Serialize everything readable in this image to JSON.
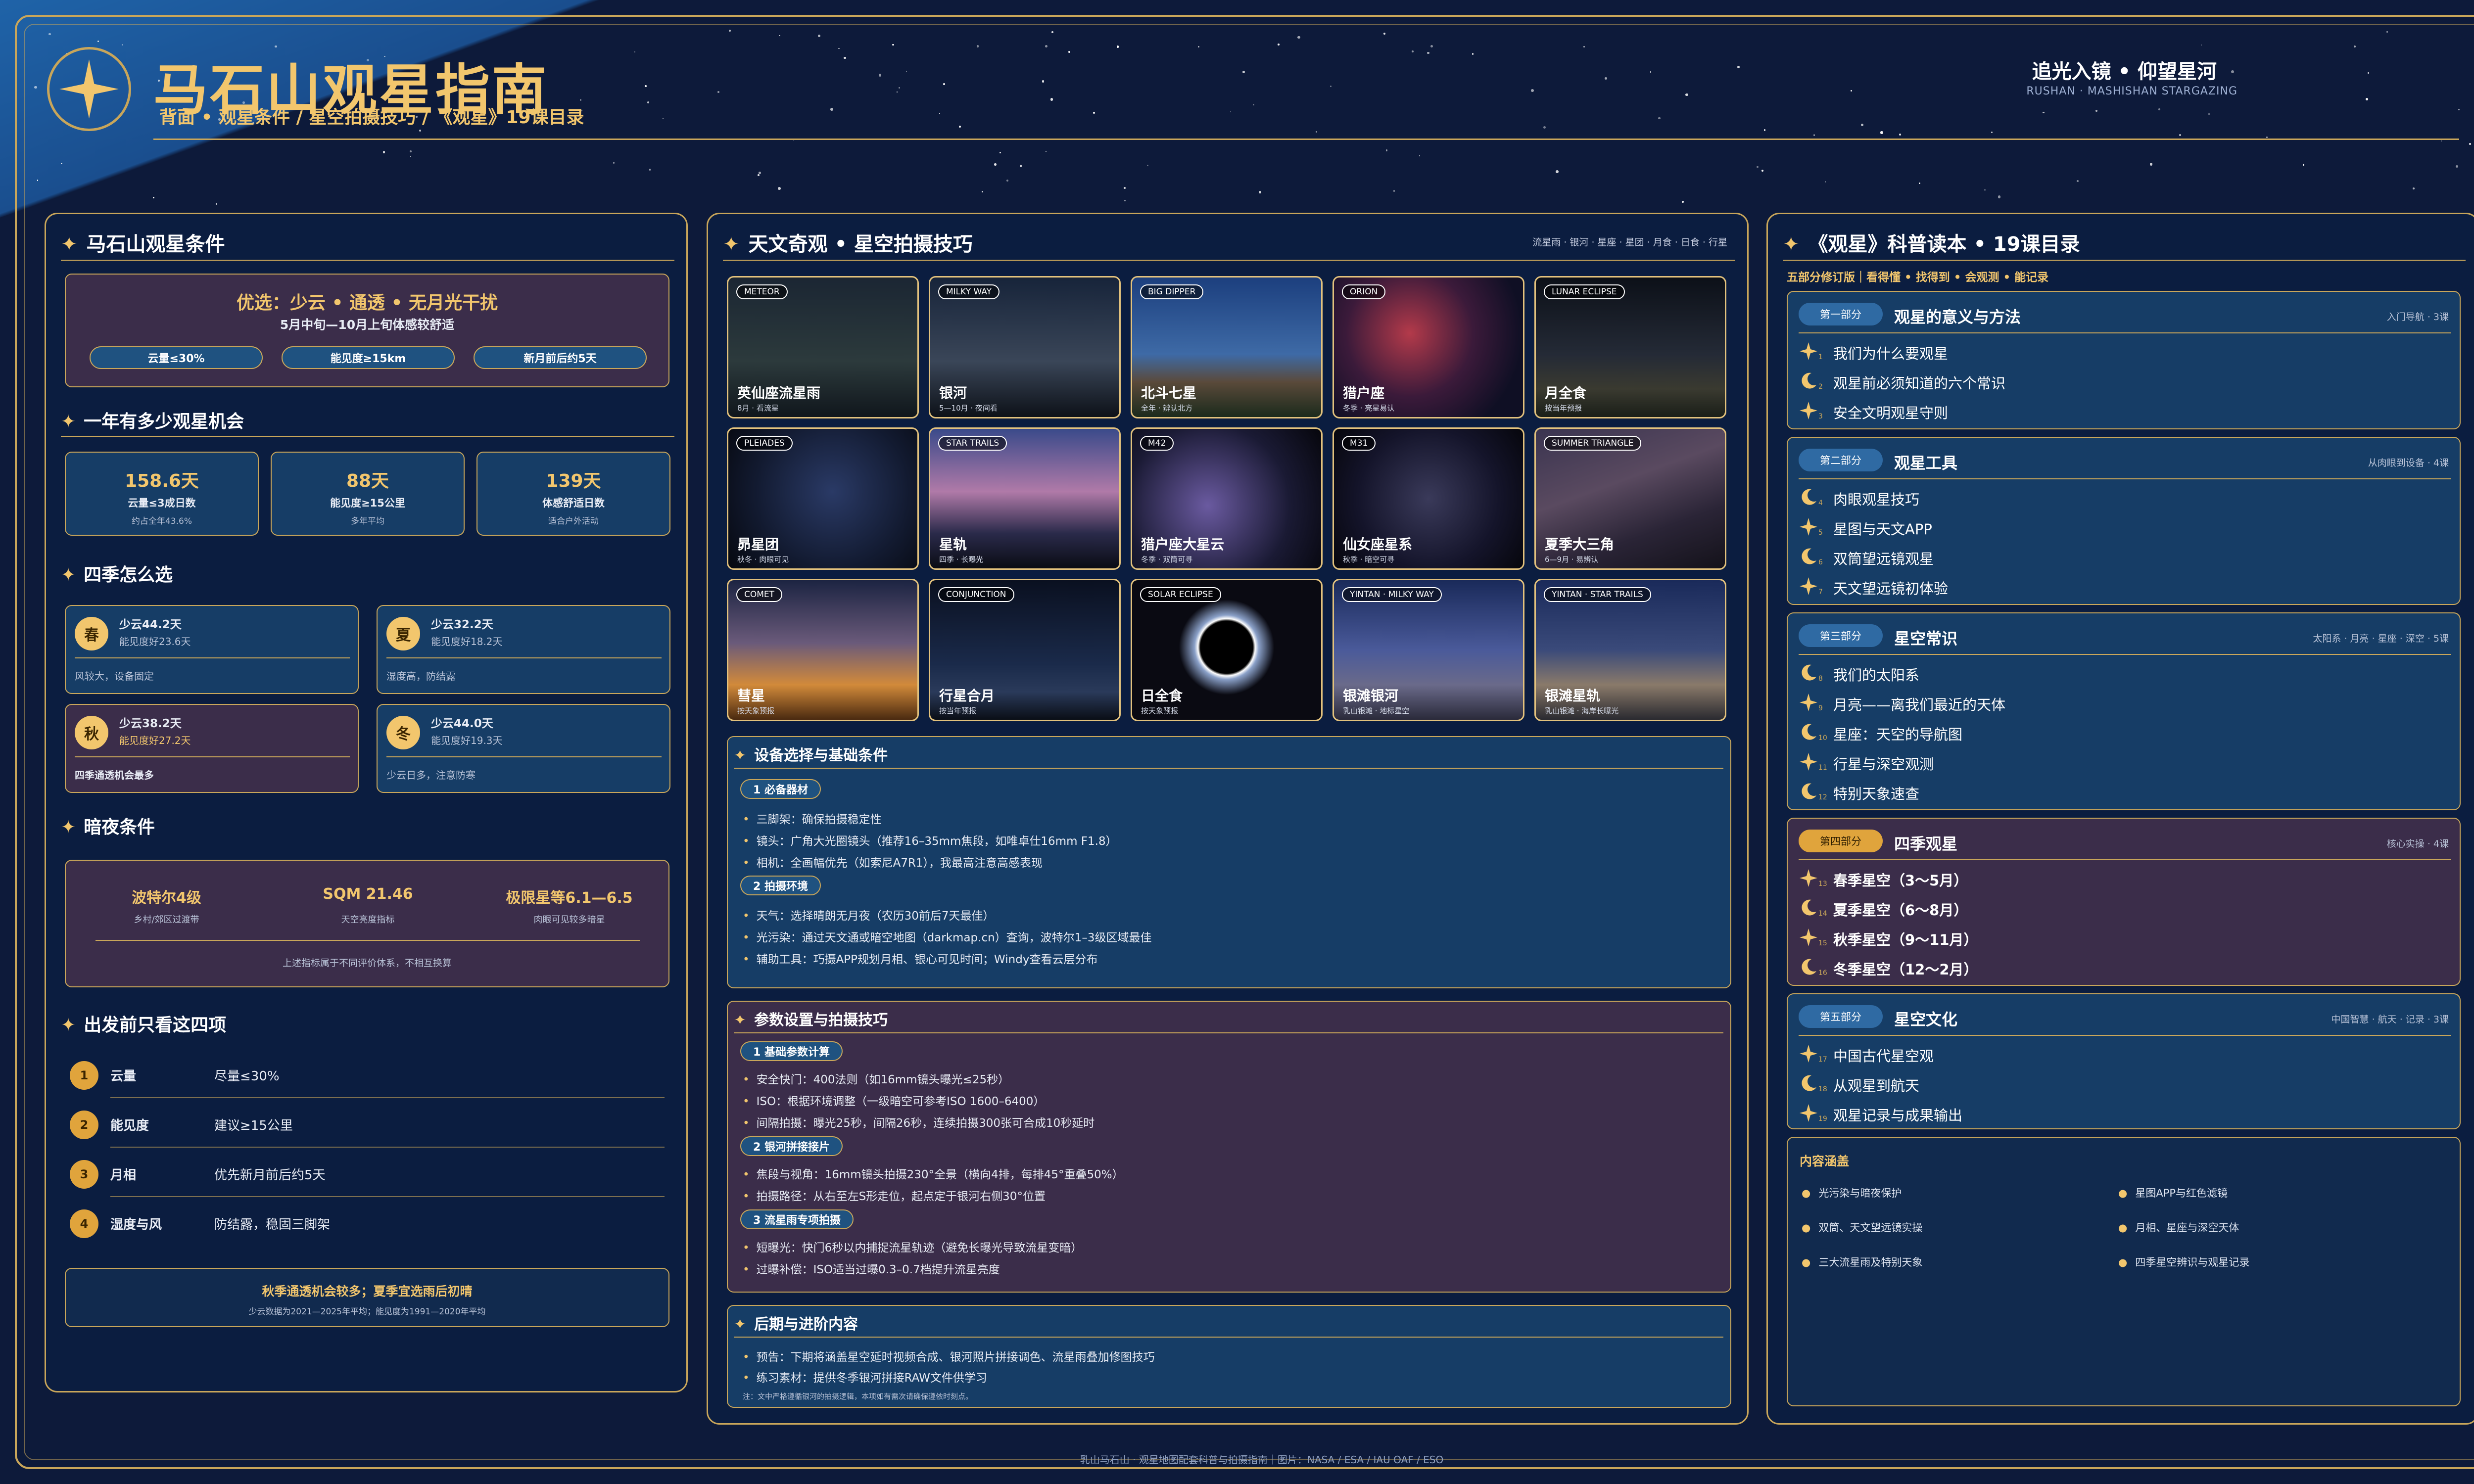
{
  "header": {
    "title": "马石山观星指南",
    "subtitle": "背面 • 观星条件  /  星空拍摄技巧  /  《观星》19课目录",
    "tagline": "追光入镜 • 仰望星河",
    "tagline_en": "RUSHAN · MASHISHAN STARGAZING"
  },
  "left": {
    "title": "马石山观星条件",
    "best": {
      "headline": "优选：少云 • 通透 • 无月光干扰",
      "period": "5月中旬—10月上旬体感较舒适",
      "pills": [
        "云量≤30%",
        "能见度≥15km",
        "新月前后约5天"
      ]
    },
    "chances": {
      "title": "一年有多少观星机会",
      "cards": [
        {
          "value": "158.6天",
          "label": "云量≤3成日数",
          "note": "约占全年43.6%"
        },
        {
          "value": "88天",
          "label": "能见度≥15公里",
          "note": "多年平均"
        },
        {
          "value": "139天",
          "label": "体感舒适日数",
          "note": "适合户外活动"
        }
      ]
    },
    "seasons": {
      "title": "四季怎么选",
      "items": [
        {
          "badge": "春",
          "line1": "少云44.2天",
          "line2": "能见度好23.6天",
          "note": "风较大，设备固定"
        },
        {
          "badge": "夏",
          "line1": "少云32.2天",
          "line2": "能见度好18.2天",
          "note": "湿度高，防结露"
        },
        {
          "badge": "秋",
          "line1": "少云38.2天",
          "line2": "能见度好27.2天",
          "note": "四季通透机会最多"
        },
        {
          "badge": "冬",
          "line1": "少云44.0天",
          "line2": "能见度好19.3天",
          "note": "少云日多，注意防寒"
        }
      ]
    },
    "dark": {
      "title": "暗夜条件",
      "stats": [
        {
          "value": "波特尔4级",
          "label": "乡村/郊区过渡带"
        },
        {
          "value": "SQM 21.46",
          "label": "天空亮度指标"
        },
        {
          "value": "极限星等6.1—6.5",
          "label": "肉眼可见较多暗星"
        }
      ],
      "note": "上述指标属于不同评价体系，不相互换算"
    },
    "checklist": {
      "title": "出发前只看这四项",
      "items": [
        {
          "num": "1",
          "name": "云量",
          "value": "尽量≤30%"
        },
        {
          "num": "2",
          "name": "能见度",
          "value": "建议≥15公里"
        },
        {
          "num": "3",
          "name": "月相",
          "value": "优先新月前后约5天"
        },
        {
          "num": "4",
          "name": "湿度与风",
          "value": "防结露，稳固三脚架"
        }
      ]
    },
    "summary": {
      "headline": "秋季通透机会较多；夏季宜选雨后初晴",
      "note": "少云数据为2021—2025年平均；能见度为1991—2020年平均"
    }
  },
  "middle": {
    "title": "天文奇观 • 星空拍摄技巧",
    "title_note": "流星雨 · 银河 · 星座 · 星团 · 月食 · 日食 · 行星",
    "photos": [
      {
        "tag": "METEOR",
        "name": "英仙座流星雨",
        "sub": "8月 · 看流星"
      },
      {
        "tag": "MILKY WAY",
        "name": "银河",
        "sub": "5—10月 · 夜间看"
      },
      {
        "tag": "BIG DIPPER",
        "name": "北斗七星",
        "sub": "全年 · 辨认北方"
      },
      {
        "tag": "ORION",
        "name": "猎户座",
        "sub": "冬季 · 亮星易认"
      },
      {
        "tag": "LUNAR ECLIPSE",
        "name": "月全食",
        "sub": "按当年预报"
      },
      {
        "tag": "PLEIADES",
        "name": "昴星团",
        "sub": "秋冬 · 肉眼可见"
      },
      {
        "tag": "STAR TRAILS",
        "name": "星轨",
        "sub": "四季 · 长曝光"
      },
      {
        "tag": "M42",
        "name": "猎户座大星云",
        "sub": "冬季 · 双筒可寻"
      },
      {
        "tag": "M31",
        "name": "仙女座星系",
        "sub": "秋季 · 暗空可寻"
      },
      {
        "tag": "SUMMER TRIANGLE",
        "name": "夏季大三角",
        "sub": "6—9月 · 易辨认"
      },
      {
        "tag": "COMET",
        "name": "彗星",
        "sub": "按天象预报"
      },
      {
        "tag": "CONJUNCTION",
        "name": "行星合月",
        "sub": "按当年预报"
      },
      {
        "tag": "SOLAR ECLIPSE",
        "name": "日全食",
        "sub": "按天象预报"
      },
      {
        "tag": "YINTAN · MILKY WAY",
        "name": "银滩银河",
        "sub": "乳山银滩 · 地标星空"
      },
      {
        "tag": "YINTAN · STAR TRAILS",
        "name": "银滩星轨",
        "sub": "乳山银滩 · 海岸长曝光"
      }
    ],
    "equipment": {
      "title": "设备选择与基础条件",
      "groups": [
        {
          "label": "1  必备器材",
          "items": [
            "三脚架：确保拍摄稳定性",
            "镜头：广角大光圈镜头（推荐16–35mm焦段，如唯卓仕16mm F1.8）",
            "相机：全画幅优先（如索尼A7R1），我最高注意高感表现"
          ]
        },
        {
          "label": "2  拍摄环境",
          "items": [
            "天气：选择晴朗无月夜（农历30前后7天最佳）",
            "光污染：通过天文通或暗空地图（darkmap.cn）查询，波特尔1–3级区域最佳",
            "辅助工具：巧摄APP规划月相、银心可见时间；Windy查看云层分布"
          ]
        }
      ]
    },
    "params": {
      "title": "参数设置与拍摄技巧",
      "groups": [
        {
          "label": "1  基础参数计算",
          "items": [
            "安全快门：400法则（如16mm镜头曝光≤25秒）",
            "ISO：根据环境调整（一级暗空可参考ISO 1600–6400）",
            "间隔拍摄：曝光25秒，间隔26秒，连续拍摄300张可合成10秒延时"
          ]
        },
        {
          "label": "2  银河拼接接片",
          "items": [
            "焦段与视角：16mm镜头拍摄230°全景（横向4排，每排45°重叠50%）",
            "拍摄路径：从右至左S形走位，起点定于银河右侧30°位置"
          ]
        },
        {
          "label": "3  流星雨专项拍摄",
          "items": [
            "短曝光：快门6秒以内捕捉流星轨迹（避免长曝光导致流星变暗）",
            "过曝补偿：ISO适当过曝0.3–0.7档提升流星亮度"
          ]
        }
      ]
    },
    "post": {
      "title": "后期与进阶内容",
      "items": [
        "预告：下期将涵盖星空延时视频合成、银河照片拼接调色、流星雨叠加修图技巧",
        "练习素材：提供冬季银河拼接RAW文件供学习"
      ],
      "note": "注：文中严格遵循银河的拍摄逻辑，本项如有需次请确保遵依时刻点。"
    }
  },
  "right": {
    "title": "《观星》科普读本 • 19课目录",
    "intro": "五部分修订版｜看得懂 • 找得到 • 会观测 • 能记录",
    "parts": [
      {
        "pill": "第一部分",
        "title": "观星的意义与方法",
        "note": "入门导航 · 3课",
        "items": [
          "我们为什么要观星",
          "观星前必须知道的六个常识",
          "安全文明观星守则"
        ]
      },
      {
        "pill": "第二部分",
        "title": "观星工具",
        "note": "从肉眼到设备 · 4课",
        "items": [
          "肉眼观星技巧",
          "星图与天文APP",
          "双筒望远镜观星",
          "天文望远镜初体验"
        ]
      },
      {
        "pill": "第三部分",
        "title": "星空常识",
        "note": "太阳系 · 月亮 · 星座 · 深空 · 5课",
        "items": [
          "我们的太阳系",
          "月亮——离我们最近的天体",
          "星座：天空的导航图",
          "行星与深空观测",
          "特别天象速查"
        ]
      },
      {
        "pill": "第四部分",
        "title": "四季观星",
        "note": "核心实操 · 4课",
        "items": [
          "春季星空（3～5月）",
          "夏季星空（6～8月）",
          "秋季星空（9～11月）",
          "冬季星空（12～2月）"
        ]
      },
      {
        "pill": "第五部分",
        "title": "星空文化",
        "note": "中国智慧 · 航天 · 记录 · 3课",
        "items": [
          "中国古代星空观",
          "从观星到航天",
          "观星记录与成果输出"
        ]
      }
    ],
    "coverage": {
      "title": "内容涵盖",
      "items": [
        "光污染与暗夜保护",
        "星图APP与红色滤镜",
        "双筒、天文望远镜实操",
        "月相、星座与深空天体",
        "三大流星雨及特别天象",
        "四季星空辨识与观星记录"
      ]
    }
  },
  "footer": "乳山马石山 · 观星地图配套科普与拍摄指南｜图片：NASA / ESA / IAU OAF / ESO",
  "colors": {
    "gold": "#c9a65a",
    "accent": "#f2c66d",
    "panel": "#0c1e42",
    "plum": "#3b2d4a",
    "blue": "#163d66"
  }
}
